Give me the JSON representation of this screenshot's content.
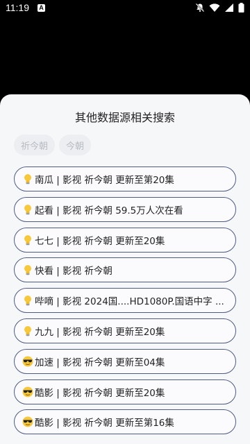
{
  "status_bar": {
    "time": "11:19",
    "notification_icon": "A"
  },
  "sheet": {
    "title": "其他数据源相关搜索",
    "chips": [
      "祈今朝",
      "今朝"
    ],
    "results": [
      {
        "icon": "bulb-icon",
        "text": "南瓜 | 影视  祈今朝  更新至第20集"
      },
      {
        "icon": "bulb-icon",
        "text": "起看 | 影视  祈今朝  59.5万人次在看"
      },
      {
        "icon": "bulb-icon",
        "text": "七七 | 影视  祈今朝  更新至20集"
      },
      {
        "icon": "bulb-icon",
        "text": "快看 | 影视  祈今朝"
      },
      {
        "icon": "bulb-icon",
        "text": "哔嘀 | 影视  2024国....HD1080P.国语中字 ..."
      },
      {
        "icon": "bulb-icon",
        "text": "九九 | 影视  祈今朝  更新至20集"
      },
      {
        "icon": "sunglasses-icon",
        "text": "加速 | 影视  祈今朝  更新至04集"
      },
      {
        "icon": "sunglasses-icon",
        "text": "酷影 | 影视  祈今朝  更新至20集"
      },
      {
        "icon": "sunglasses-icon",
        "text": "酷影 | 影视  祈今朝  更新至第16集"
      }
    ]
  }
}
